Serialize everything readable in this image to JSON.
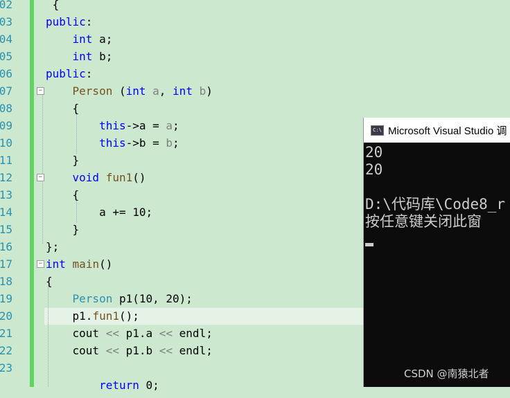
{
  "code_lines": [
    {
      "num": "02",
      "tokens": [
        {
          "t": " {",
          "c": ""
        }
      ]
    },
    {
      "num": "03",
      "tokens": [
        {
          "t": "public",
          "c": "kw"
        },
        {
          "t": ":",
          "c": ""
        }
      ]
    },
    {
      "num": "04",
      "tokens": [
        {
          "t": "    ",
          "c": ""
        },
        {
          "t": "int",
          "c": "kw"
        },
        {
          "t": " a;",
          "c": ""
        }
      ]
    },
    {
      "num": "05",
      "tokens": [
        {
          "t": "    ",
          "c": ""
        },
        {
          "t": "int",
          "c": "kw"
        },
        {
          "t": " b;",
          "c": ""
        }
      ]
    },
    {
      "num": "06",
      "tokens": [
        {
          "t": "public",
          "c": "kw"
        },
        {
          "t": ":",
          "c": ""
        }
      ]
    },
    {
      "num": "07",
      "tokens": [
        {
          "t": "    ",
          "c": ""
        },
        {
          "t": "Person",
          "c": "fn"
        },
        {
          "t": " (",
          "c": ""
        },
        {
          "t": "int",
          "c": "kw"
        },
        {
          "t": " ",
          "c": ""
        },
        {
          "t": "a",
          "c": "param"
        },
        {
          "t": ", ",
          "c": ""
        },
        {
          "t": "int",
          "c": "kw"
        },
        {
          "t": " ",
          "c": ""
        },
        {
          "t": "b",
          "c": "param"
        },
        {
          "t": ")",
          "c": ""
        }
      ]
    },
    {
      "num": "08",
      "tokens": [
        {
          "t": "    {",
          "c": ""
        }
      ]
    },
    {
      "num": "09",
      "tokens": [
        {
          "t": "        ",
          "c": ""
        },
        {
          "t": "this",
          "c": "kw"
        },
        {
          "t": "->a = ",
          "c": ""
        },
        {
          "t": "a",
          "c": "param"
        },
        {
          "t": ";",
          "c": ""
        }
      ]
    },
    {
      "num": "10",
      "tokens": [
        {
          "t": "        ",
          "c": ""
        },
        {
          "t": "this",
          "c": "kw"
        },
        {
          "t": "->b = ",
          "c": ""
        },
        {
          "t": "b",
          "c": "param"
        },
        {
          "t": ";",
          "c": ""
        }
      ]
    },
    {
      "num": "11",
      "tokens": [
        {
          "t": "    }",
          "c": ""
        }
      ]
    },
    {
      "num": "12",
      "tokens": [
        {
          "t": "    ",
          "c": ""
        },
        {
          "t": "void",
          "c": "kw"
        },
        {
          "t": " ",
          "c": ""
        },
        {
          "t": "fun1",
          "c": "fn"
        },
        {
          "t": "()",
          "c": ""
        }
      ]
    },
    {
      "num": "13",
      "tokens": [
        {
          "t": "    {",
          "c": ""
        }
      ]
    },
    {
      "num": "14",
      "tokens": [
        {
          "t": "        a += 10;",
          "c": ""
        }
      ]
    },
    {
      "num": "15",
      "tokens": [
        {
          "t": "    }",
          "c": ""
        }
      ]
    },
    {
      "num": "16",
      "tokens": [
        {
          "t": "};",
          "c": ""
        }
      ]
    },
    {
      "num": "17",
      "tokens": [
        {
          "t": "int",
          "c": "kw"
        },
        {
          "t": " ",
          "c": ""
        },
        {
          "t": "main",
          "c": "fn"
        },
        {
          "t": "()",
          "c": ""
        }
      ]
    },
    {
      "num": "18",
      "tokens": [
        {
          "t": "{",
          "c": ""
        }
      ]
    },
    {
      "num": "19",
      "tokens": [
        {
          "t": "    ",
          "c": ""
        },
        {
          "t": "Person",
          "c": "type"
        },
        {
          "t": " p1(10, 20);",
          "c": ""
        }
      ]
    },
    {
      "num": "20",
      "tokens": [
        {
          "t": "    p1.",
          "c": ""
        },
        {
          "t": "fun1",
          "c": "fn"
        },
        {
          "t": "();",
          "c": ""
        }
      ]
    },
    {
      "num": "21",
      "tokens": [
        {
          "t": "    cout ",
          "c": ""
        },
        {
          "t": "<<",
          "c": "param"
        },
        {
          "t": " p1.a ",
          "c": ""
        },
        {
          "t": "<<",
          "c": "param"
        },
        {
          "t": " endl;",
          "c": ""
        }
      ]
    },
    {
      "num": "22",
      "tokens": [
        {
          "t": "    cout ",
          "c": ""
        },
        {
          "t": "<<",
          "c": "param"
        },
        {
          "t": " p1.b ",
          "c": ""
        },
        {
          "t": "<<",
          "c": "param"
        },
        {
          "t": " endl;",
          "c": ""
        }
      ]
    },
    {
      "num": "23",
      "tokens": [
        {
          "t": "",
          "c": ""
        }
      ]
    },
    {
      "num": "",
      "tokens": [
        {
          "t": "        ",
          "c": ""
        },
        {
          "t": "return",
          "c": "kw"
        },
        {
          "t": " 0;",
          "c": ""
        }
      ]
    }
  ],
  "console": {
    "title": "Microsoft Visual Studio 调",
    "icon_label": "C:\\",
    "lines": [
      "20",
      "20",
      "",
      "D:\\代码库\\Code8_r",
      "按任意键关闭此窗"
    ]
  },
  "watermark": "CSDN @南猿北者"
}
